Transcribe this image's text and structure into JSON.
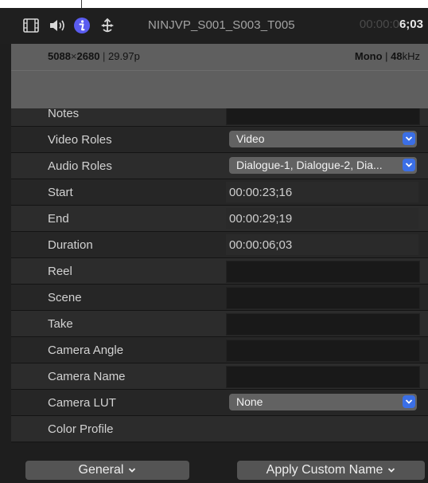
{
  "toolbar": {
    "icons": [
      "film-icon",
      "speaker-icon",
      "info-icon",
      "share-icon"
    ],
    "clip_name": "NINJVP_S001_S003_T005",
    "timecode_dim": "00:00:0",
    "timecode_bright": "6;03"
  },
  "header": {
    "resolution_w": "5088",
    "resolution_x": "×",
    "resolution_h": "2680",
    "framerate": "29.97p",
    "audio_channels": "Mono",
    "audio_rate_num": "48",
    "audio_rate_unit": "kHz"
  },
  "rows": [
    {
      "label": "Notes",
      "kind": "field"
    },
    {
      "label": "Video Roles",
      "kind": "popup",
      "value": "Video"
    },
    {
      "label": "Audio Roles",
      "kind": "popup",
      "value": "Dialogue-1, Dialogue-2, Dia..."
    },
    {
      "label": "Start",
      "kind": "text",
      "value": "00:00:23;16"
    },
    {
      "label": "End",
      "kind": "text",
      "value": "00:00:29;19"
    },
    {
      "label": "Duration",
      "kind": "text",
      "value": "00:00:06;03"
    },
    {
      "label": "Reel",
      "kind": "field"
    },
    {
      "label": "Scene",
      "kind": "field"
    },
    {
      "label": "Take",
      "kind": "field"
    },
    {
      "label": "Camera Angle",
      "kind": "field"
    },
    {
      "label": "Camera Name",
      "kind": "field"
    },
    {
      "label": "Camera LUT",
      "kind": "popup",
      "value": "None"
    },
    {
      "label": "Color Profile",
      "kind": "empty"
    }
  ],
  "bottom": {
    "metadata_view_label": "General",
    "apply_name_label": "Apply Custom Name"
  },
  "colors": {
    "accent": "#3b6fe6",
    "info_icon": "#5a5cf0"
  }
}
